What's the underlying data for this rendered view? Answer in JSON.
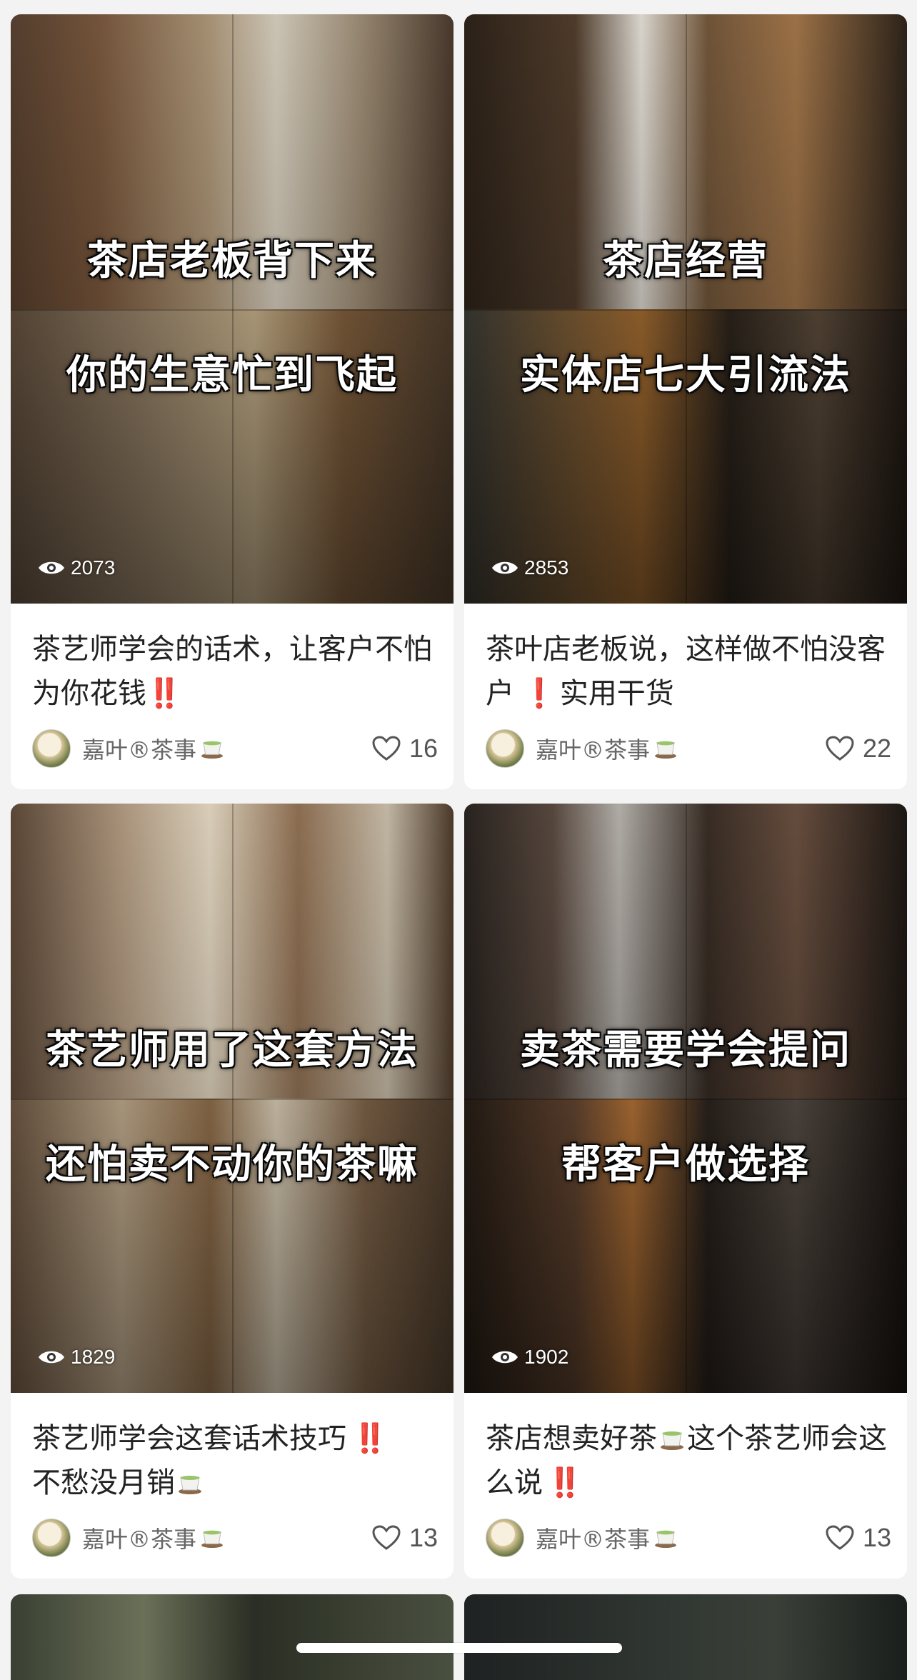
{
  "feed": {
    "cards": [
      {
        "overlay_lines": [
          "茶店老板背下来",
          "你的生意忙到飞起"
        ],
        "views": "2073",
        "caption_text": "茶艺师学会的话术，让客户不怕为你花钱",
        "caption_suffix": "‼️",
        "author": "嘉叶®茶事",
        "likes": "16"
      },
      {
        "overlay_lines": [
          "茶店经营",
          "实体店七大引流法"
        ],
        "views": "2853",
        "caption_text": "茶叶店老板说，这样做不怕没客户",
        "caption_mid": "❗",
        "caption_tail": "实用干货",
        "author": "嘉叶®茶事",
        "likes": "22"
      },
      {
        "overlay_lines": [
          "茶艺师用了这套方法",
          "还怕卖不动你的茶嘛"
        ],
        "views": "1829",
        "caption_text": "茶艺师学会这套话术技巧",
        "caption_mid": "‼️",
        "caption_tail": "不愁没月销",
        "author": "嘉叶®茶事",
        "likes": "13"
      },
      {
        "overlay_lines": [
          "卖茶需要学会提问",
          "帮客户做选择"
        ],
        "views": "1902",
        "caption_text": "茶店想卖好茶",
        "caption_tail": "这个茶艺师会这么说",
        "caption_suffix": "‼️",
        "author": "嘉叶®茶事",
        "likes": "13"
      }
    ]
  },
  "icons": {
    "eye": "eye-icon",
    "heart": "heart-outline-icon",
    "tea": "tea-cup-emoji"
  },
  "colors": {
    "background": "#f3f3f3",
    "card": "#ffffff",
    "accent_exclamation": "#e22a2a",
    "author_text": "#666666"
  }
}
